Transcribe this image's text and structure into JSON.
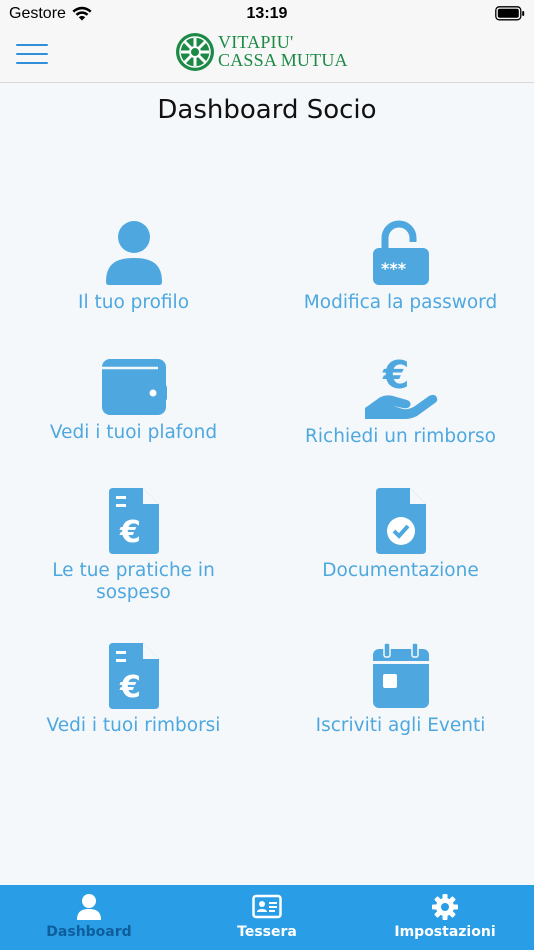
{
  "status_bar": {
    "carrier": "Gestore",
    "time": "13:19"
  },
  "header": {
    "logo_line1": "VITAPIU'",
    "logo_line2": "CASSA MUTUA"
  },
  "page": {
    "title": "Dashboard Socio"
  },
  "tiles": [
    {
      "label": "Il tuo profilo",
      "icon": "user-icon"
    },
    {
      "label": "Modifica la password",
      "icon": "unlock-password-icon"
    },
    {
      "label": "Vedi i tuoi plafond",
      "icon": "wallet-icon"
    },
    {
      "label": "Richiedi un rimborso",
      "icon": "euro-hand-icon"
    },
    {
      "label": "Le tue pratiche in sospeso",
      "icon": "euro-document-icon"
    },
    {
      "label": "Documentazione",
      "icon": "document-check-icon"
    },
    {
      "label": "Vedi i tuoi rimborsi",
      "icon": "euro-document-icon"
    },
    {
      "label": "Iscriviti agli Eventi",
      "icon": "calendar-icon"
    }
  ],
  "tabs": [
    {
      "label": "Dashboard",
      "icon": "user-icon",
      "active": true
    },
    {
      "label": "Tessera",
      "icon": "id-card-icon",
      "active": false
    },
    {
      "label": "Impostazioni",
      "icon": "gear-icon",
      "active": false
    }
  ],
  "colors": {
    "accent": "#4ea8df",
    "tabbar": "#2a9de7",
    "brand_green": "#1c8a46",
    "icon_blue": "#4ea8df"
  }
}
